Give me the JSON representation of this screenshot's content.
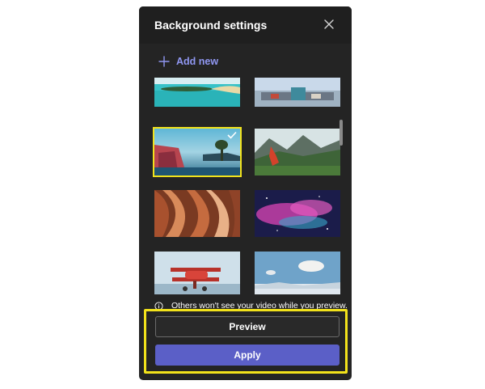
{
  "dialog": {
    "title": "Background settings",
    "add_new_label": "Add new",
    "info_text": "Others won't see your video while you preview.",
    "preview_label": "Preview",
    "apply_label": "Apply"
  },
  "backgrounds": [
    {
      "name": "tropical-beach",
      "selected": false
    },
    {
      "name": "coastal-town",
      "selected": false
    },
    {
      "name": "lake-island-sunset",
      "selected": true
    },
    {
      "name": "mountain-valley",
      "selected": false
    },
    {
      "name": "red-rock-canyon",
      "selected": false
    },
    {
      "name": "pink-nebula",
      "selected": false
    },
    {
      "name": "red-biplane",
      "selected": false
    },
    {
      "name": "snowy-sky",
      "selected": false
    }
  ],
  "icons": {
    "close": "close-icon",
    "add": "plus-icon",
    "info": "info-icon",
    "selected": "checkmark-icon"
  },
  "colors": {
    "panel": "#242424",
    "accent": "#5b5fc7",
    "link": "#9097f2",
    "highlight": "#f2e21b"
  }
}
